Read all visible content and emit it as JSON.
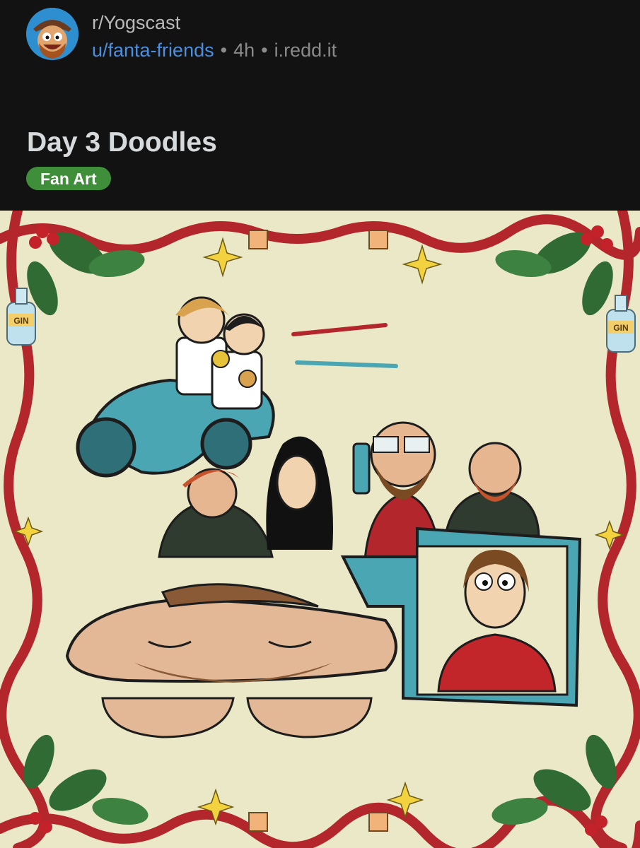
{
  "post": {
    "subreddit": "r/Yogscast",
    "author": "u/fanta-friends",
    "separator": "•",
    "age": "4h",
    "domain": "i.redd.it",
    "title": "Day 3 Doodles",
    "flair": "Fan Art"
  },
  "image": {
    "bottle_label": "GIN"
  },
  "colors": {
    "background": "#121212",
    "flair": "#3f8f3a",
    "author_link": "#4b8fe0",
    "ribbon": "#b3262b",
    "holly": "#2f6b32",
    "canvas": "#ebe8c8"
  },
  "icons": [
    "subreddit-avatar-icon"
  ]
}
